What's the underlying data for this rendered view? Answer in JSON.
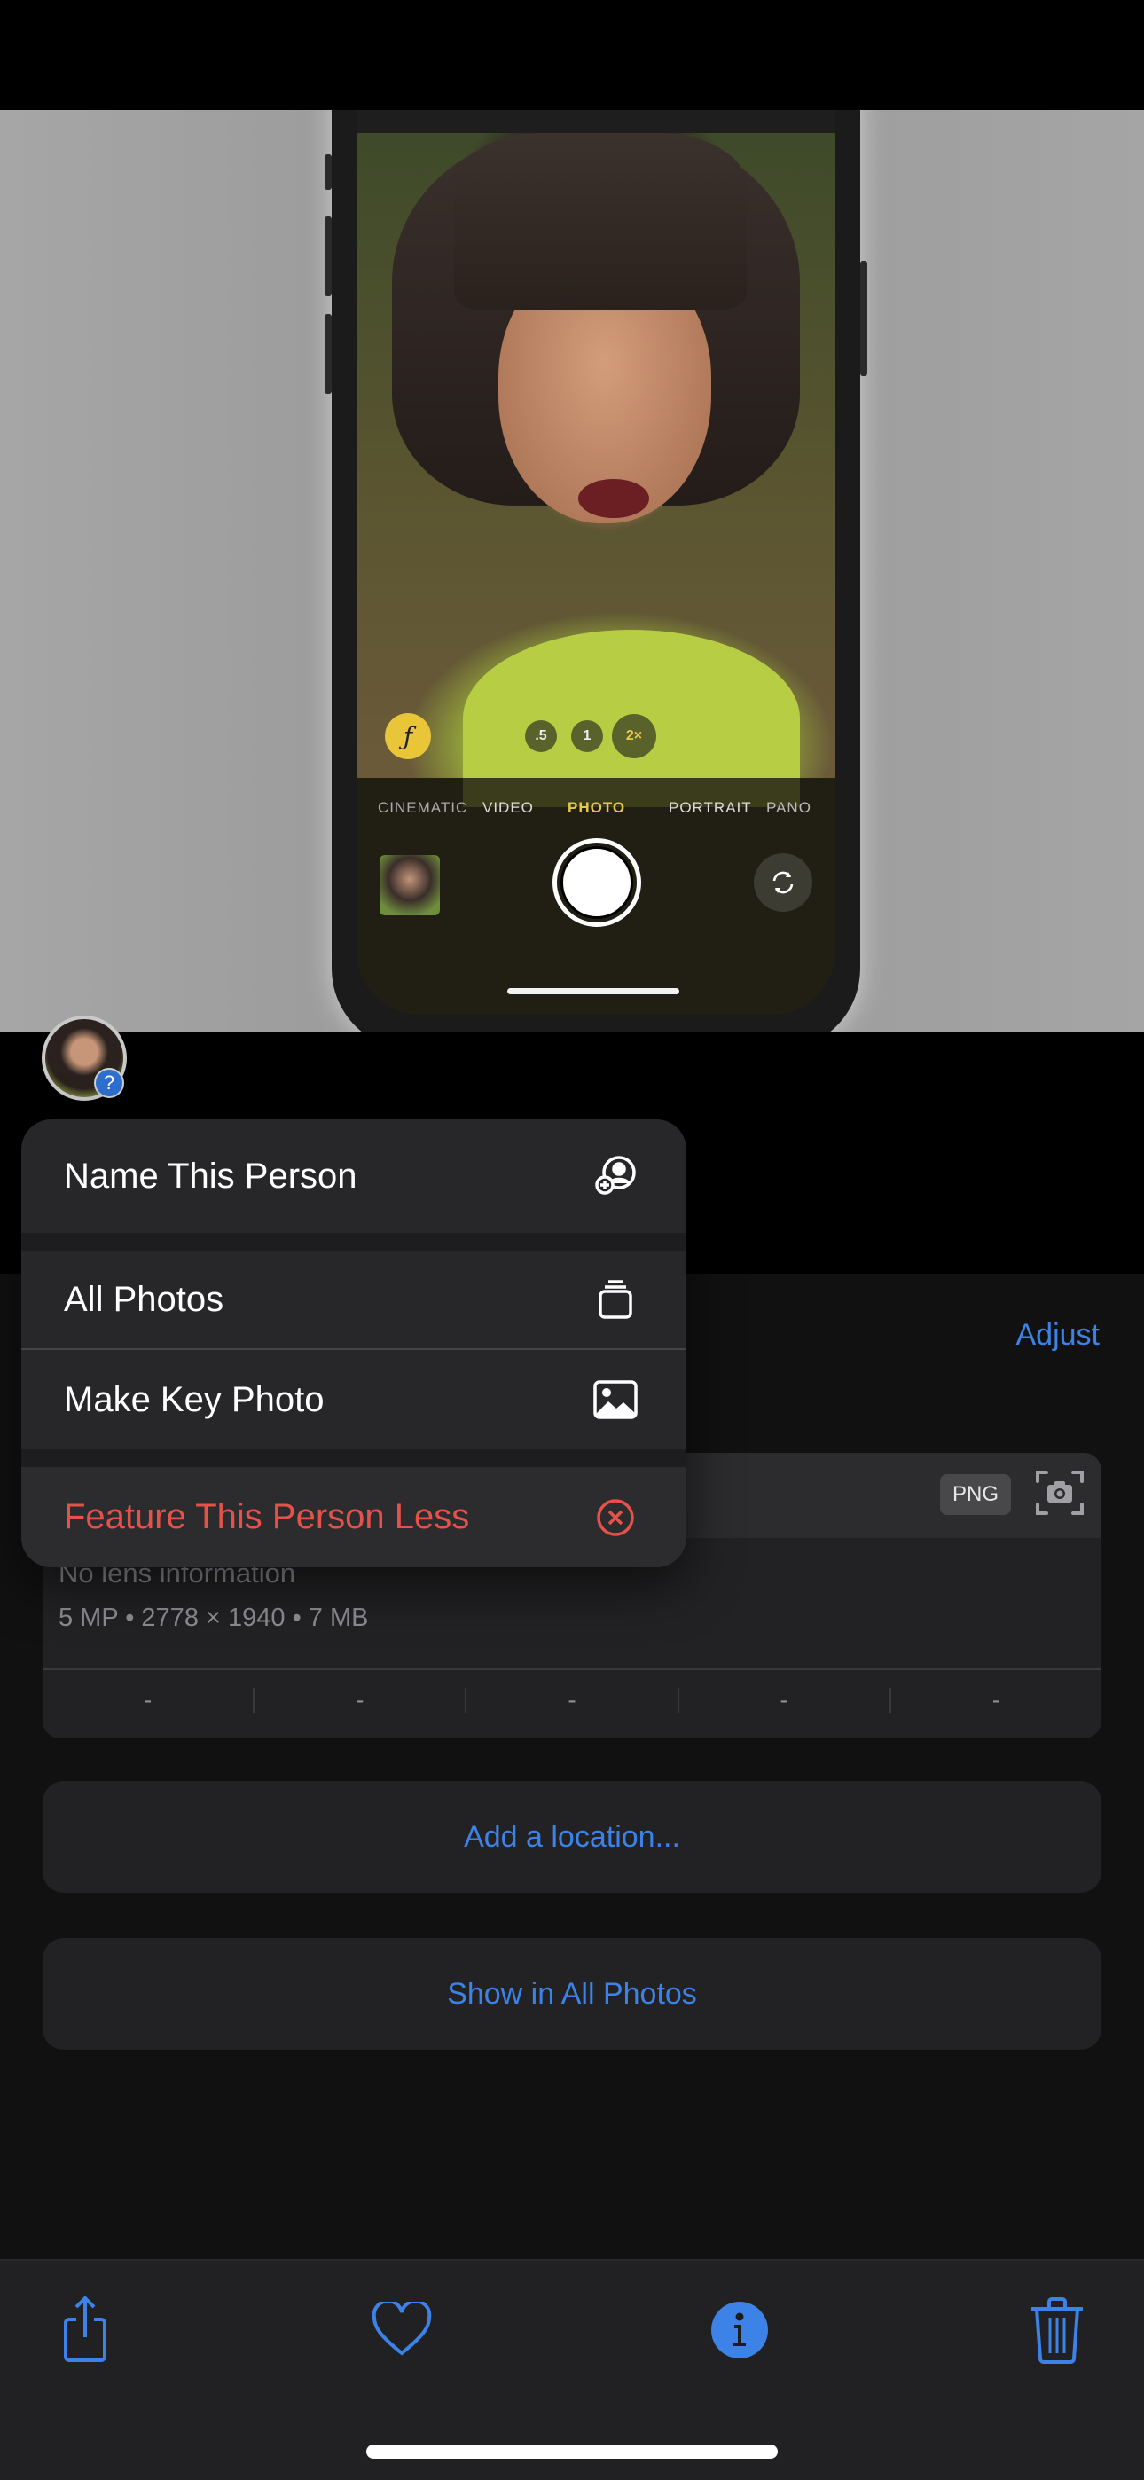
{
  "camera_preview": {
    "aperture_button": "ƒ",
    "zoom_levels": [
      ".5",
      "1",
      "2×"
    ],
    "active_zoom": "2×",
    "modes": [
      "CINEMATIC",
      "VIDEO",
      "PHOTO",
      "PORTRAIT",
      "PANO"
    ],
    "active_mode": "PHOTO"
  },
  "person": {
    "badge": "?"
  },
  "context_menu": {
    "items": [
      {
        "label": "Name This Person",
        "icon": "person-add-icon"
      },
      {
        "label": "All Photos",
        "icon": "photo-stack-icon"
      },
      {
        "label": "Make Key Photo",
        "icon": "photo-icon"
      },
      {
        "label": "Feature This Person Less",
        "icon": "x-circle-icon",
        "destructive": true
      }
    ]
  },
  "info": {
    "adjust_label": "Adjust",
    "format_badge": "PNG",
    "lens": "No lens information",
    "specs": "5 MP  •  2778 × 1940  •  7 MB",
    "exif": [
      "-",
      "-",
      "-",
      "-",
      "-"
    ],
    "add_location": "Add a location...",
    "show_in_all_photos": "Show in All Photos"
  },
  "toolbar": {
    "items": [
      "share",
      "favorite",
      "info",
      "delete"
    ]
  },
  "colors": {
    "accent": "#3d82e6",
    "destructive": "#e5524a",
    "camera_active": "#e8c84c"
  }
}
